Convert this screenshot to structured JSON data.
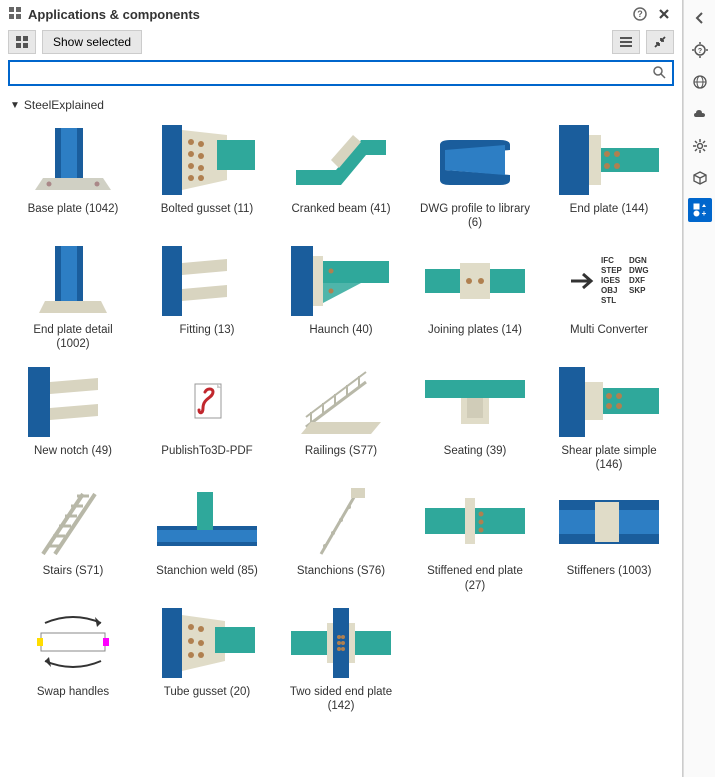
{
  "title": "Applications & components",
  "toolbar": {
    "show_selected": "Show selected"
  },
  "search": {
    "placeholder": ""
  },
  "group": {
    "name": "SteelExplained"
  },
  "items": [
    {
      "label": "Base plate (1042)"
    },
    {
      "label": "Bolted gusset (11)"
    },
    {
      "label": "Cranked beam (41)"
    },
    {
      "label": "DWG profile to library (6)"
    },
    {
      "label": "End plate (144)"
    },
    {
      "label": "End plate detail (1002)"
    },
    {
      "label": "Fitting (13)"
    },
    {
      "label": "Haunch (40)"
    },
    {
      "label": "Joining plates (14)"
    },
    {
      "label": "Multi Converter"
    },
    {
      "label": "New notch (49)"
    },
    {
      "label": "PublishTo3D-PDF"
    },
    {
      "label": "Railings (S77)"
    },
    {
      "label": "Seating (39)"
    },
    {
      "label": "Shear plate simple (146)"
    },
    {
      "label": "Stairs (S71)"
    },
    {
      "label": "Stanchion weld (85)"
    },
    {
      "label": "Stanchions (S76)"
    },
    {
      "label": "Stiffened end plate (27)"
    },
    {
      "label": "Stiffeners (1003)"
    },
    {
      "label": "Swap handles"
    },
    {
      "label": "Tube gusset (20)"
    },
    {
      "label": "Two sided end plate (142)"
    }
  ],
  "converter_formats": {
    "col1": [
      "IFC",
      "STEP",
      "IGES",
      "OBJ",
      "STL"
    ],
    "col2": [
      "DGN",
      "DWG",
      "DXF",
      "SKP"
    ]
  }
}
